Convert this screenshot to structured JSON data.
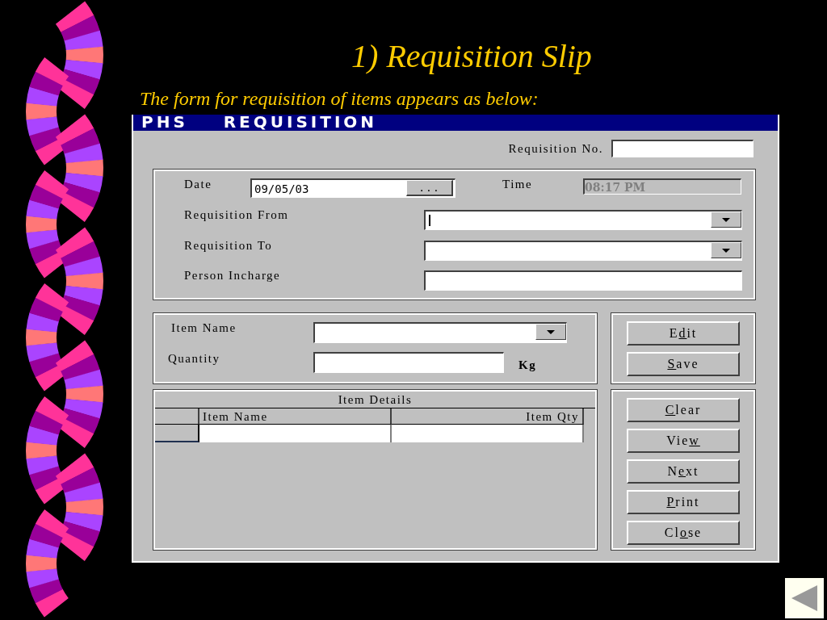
{
  "slide": {
    "title": "1) Requisition Slip",
    "subtitle": "The form for requisition of items appears as below:"
  },
  "window": {
    "title": "PHS    REQUISITION"
  },
  "requisition_no": {
    "label": "Requisition No."
  },
  "header_group": {
    "date": {
      "label": "Date",
      "value": "09/05/03",
      "button": "..."
    },
    "time": {
      "label": "Time",
      "value": "08:17 PM"
    },
    "fields": [
      {
        "kind": "dropdown",
        "label": "Requisition From",
        "focused": true
      },
      {
        "kind": "dropdown",
        "label": "Requisition To",
        "focused": false
      },
      {
        "kind": "text",
        "label": "Person Incharge",
        "focused": false
      }
    ]
  },
  "item_group": {
    "item_name": {
      "label": "Item Name"
    },
    "quantity": {
      "label": "Quantity",
      "unit": "Kg"
    }
  },
  "item_details": {
    "title": "Item Details",
    "columns": [
      "Item Name",
      "Item Qty"
    ]
  },
  "buttons_top": [
    {
      "before": "E",
      "key": "d",
      "after": "it"
    },
    {
      "key": "S",
      "after": "ave"
    }
  ],
  "buttons_bottom": [
    {
      "key": "C",
      "after": "lear"
    },
    {
      "before": "Vie",
      "key": "w"
    },
    {
      "before": "N",
      "key": "e",
      "after": "xt"
    },
    {
      "key": "P",
      "after": "rint"
    },
    {
      "before": "Cl",
      "key": "o",
      "after": "se"
    }
  ]
}
